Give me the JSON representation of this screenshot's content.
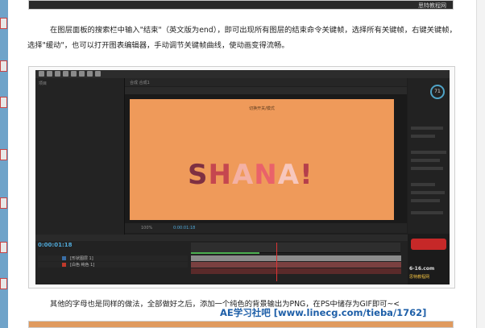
{
  "article": {
    "paragraph_1": "在图层面板的搜索栏中输入\"结束\"（英文版为end），即可出现所有图层的结束命令关键帧，选择所有关键帧，右键关键帧，选择\"缓动\"，也可以打开图表编辑器，手动调节关键帧曲线，使动画变得流畅。",
    "paragraph_2": "其他的字母也是同样的做法，全部做好之后，添加一个纯色的背景输出为PNG，在PS中储存为GIF即可~<",
    "footer_watermark": "AE学习社吧 [www.linecg.com/tieba/1762]",
    "top_image_watermark": "思特教程网"
  },
  "screenshot": {
    "project_panel_title": "项目",
    "comp_tab": "合成 合成1",
    "canvas_caption": "切换开关/模式",
    "logo_letters": [
      "S",
      "H",
      "A",
      "N",
      "A",
      "!"
    ],
    "zoom": "100%",
    "timecode_viewer": "0:00:01:18",
    "timeline_timecode": "0:00:01:18",
    "layers": [
      {
        "num": "1",
        "name": "[形状图层 1]",
        "color": "#3a6ea5"
      },
      {
        "num": "2",
        "name": "[白色 纯色 1]",
        "color": "#c0392b"
      }
    ],
    "gauge_value": "71",
    "stamp_text": "6-16.com",
    "stamp_url": "思特教程网"
  },
  "colors": {
    "canvas_bg": "#ef9a5a",
    "ui_dark": "#1e1e1e",
    "timecode": "#4fa8d8",
    "watermark": "#1e5fa8"
  }
}
